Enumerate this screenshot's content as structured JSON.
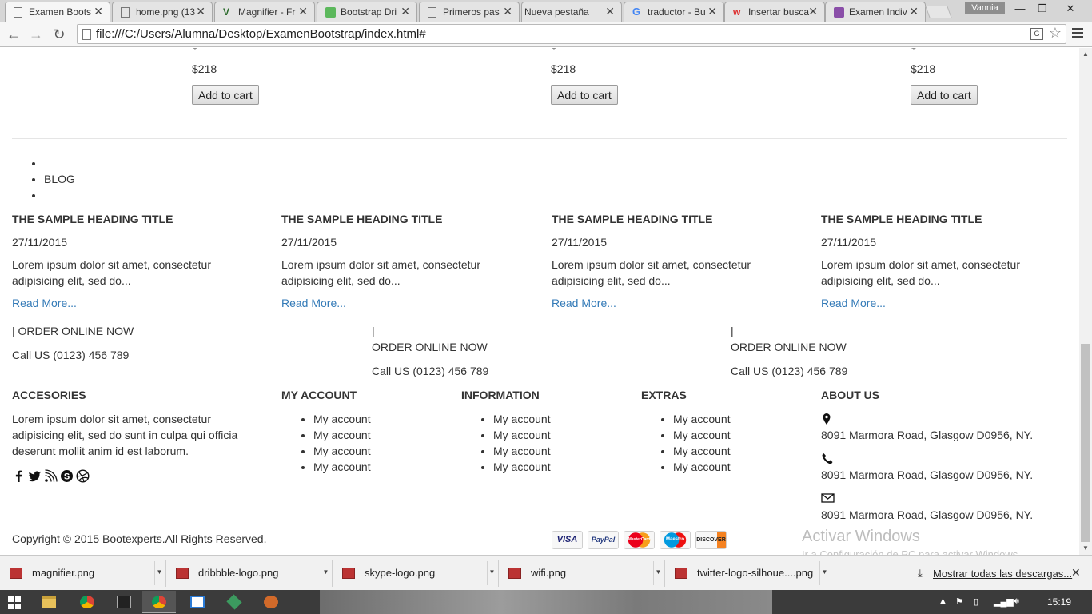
{
  "browser": {
    "tabs": [
      {
        "title": "Examen Boots",
        "favicon": "page-icon",
        "active": true
      },
      {
        "title": "home.png (13",
        "favicon": "page-icon"
      },
      {
        "title": "Magnifier - Fr",
        "favicon": "vee-icon"
      },
      {
        "title": "Bootstrap Dri",
        "favicon": "bootstrap-icon"
      },
      {
        "title": "Primeros pas",
        "favicon": "page-icon"
      },
      {
        "title": "Nueva pestaña",
        "favicon": "none"
      },
      {
        "title": "traductor - Bu",
        "favicon": "google-icon"
      },
      {
        "title": "Insertar busca",
        "favicon": "w-icon"
      },
      {
        "title": "Examen Indiv",
        "favicon": "trello-icon"
      }
    ],
    "user": "Vannia",
    "url": "file:///C:/Users/Alumna/Desktop/ExamenBootstrap/index.html#"
  },
  "products": {
    "price": "$218",
    "button_label": "Add to cart",
    "dollar_fragment": "$"
  },
  "nav_list": {
    "items": [
      "",
      "BLOG",
      ""
    ]
  },
  "blog": {
    "posts": [
      {
        "title": "THE SAMPLE HEADING TITLE",
        "date": "27/11/2015",
        "excerpt": "Lorem ipsum dolor sit amet, consectetur adipisicing elit, sed do...",
        "link": "Read More..."
      },
      {
        "title": "THE SAMPLE HEADING TITLE",
        "date": "27/11/2015",
        "excerpt": "Lorem ipsum dolor sit amet, consectetur adipisicing elit, sed do...",
        "link": "Read More..."
      },
      {
        "title": "THE SAMPLE HEADING TITLE",
        "date": "27/11/2015",
        "excerpt": "Lorem ipsum dolor sit amet, consectetur adipisicing elit, sed do...",
        "link": "Read More..."
      },
      {
        "title": "THE SAMPLE HEADING TITLE",
        "date": "27/11/2015",
        "excerpt": "Lorem ipsum dolor sit amet, consectetur adipisicing elit, sed do...",
        "link": "Read More..."
      }
    ]
  },
  "order": {
    "first_line": "| ORDER ONLINE NOW",
    "separator": "|",
    "label": "ORDER ONLINE NOW",
    "phone": "Call US (0123) 456 789"
  },
  "footer": {
    "accessories": {
      "heading": "ACCESORIES",
      "text": "Lorem ipsum dolor sit amet, consectetur adipisicing elit, sed do sunt in culpa qui officia deserunt mollit anim id est laborum.",
      "social_icons": [
        "facebook-icon",
        "twitter-icon",
        "rss-icon",
        "skype-icon",
        "dribbble-icon"
      ]
    },
    "my_account": {
      "heading": "MY ACCOUNT",
      "items": [
        "My account",
        "My account",
        "My account",
        "My account"
      ]
    },
    "information": {
      "heading": "INFORMATION",
      "items": [
        "My account",
        "My account",
        "My account",
        "My account"
      ]
    },
    "extras": {
      "heading": "EXTRAS",
      "items": [
        "My account",
        "My account",
        "My account",
        "My account"
      ]
    },
    "about": {
      "heading": "ABOUT US",
      "address_lines": [
        "8091 Marmora Road, Glasgow D0956, NY.",
        "8091 Marmora Road, Glasgow D0956, NY.",
        "8091 Marmora Road, Glasgow D0956, NY."
      ],
      "icons": [
        "map-pin-icon",
        "phone-icon",
        "mail-icon"
      ]
    },
    "copyright": "Copyright © 2015 Bootexperts.All Rights Reserved.",
    "payments": [
      "VISA",
      "PayPal",
      "MasterCard",
      "Maestro",
      "DISCOVER"
    ]
  },
  "watermark": {
    "title": "Activar Windows",
    "subtitle": "Ir a Configuración de PC para activar Windows."
  },
  "downloads": {
    "files": [
      "magnifier.png",
      "dribbble-logo.png",
      "skype-logo.png",
      "wifi.png",
      "twitter-logo-silhoue....png"
    ],
    "show_all": "Mostrar todas las descargas..."
  },
  "taskbar": {
    "time": "15:19"
  }
}
